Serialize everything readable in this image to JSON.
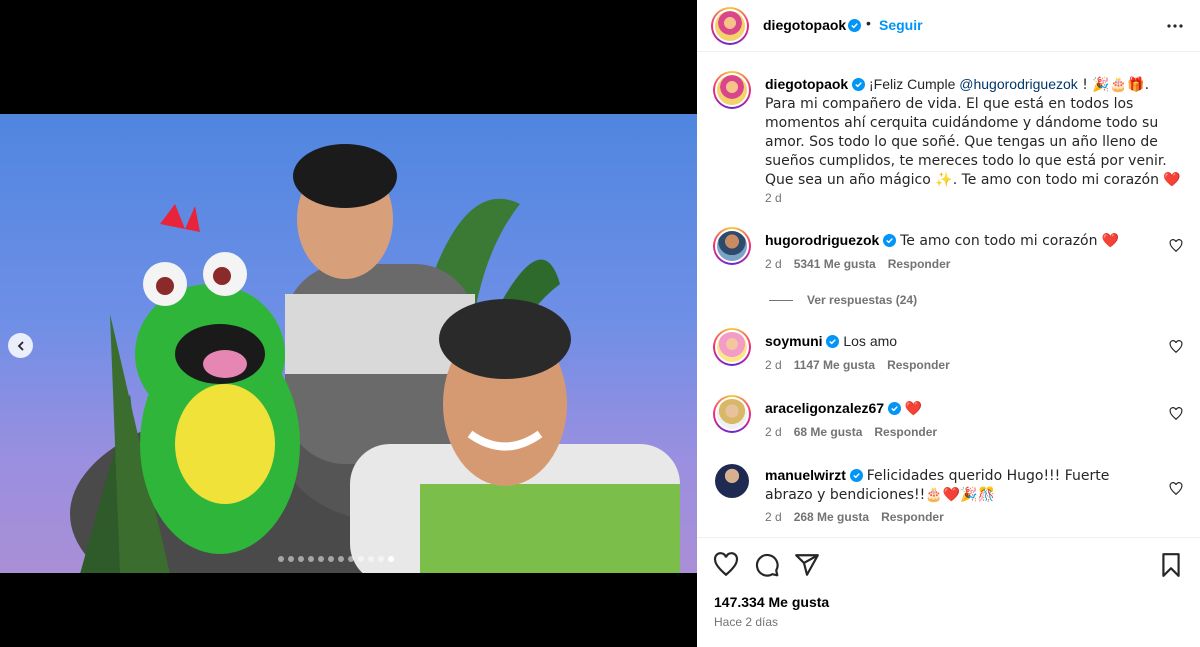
{
  "post": {
    "author": "diegotopaok",
    "follow_label": "Seguir",
    "more_icon": "more-horizontal-icon",
    "caption": {
      "pre": "¡Feliz Cumple ",
      "mention": "@hugorodriguezok",
      "post": " ! 🎉🎂🎁. Para mi compañero de vida. El que está en todos los momentos ahí cerquita cuidándome y dándome todo su amor. Sos todo lo que soñé. Que tengas un año lleno de sueños cumplidos, te mereces todo lo que está por venir. Que sea un año mágico ✨. Te amo con todo mi corazón ❤️",
      "time": "2 d"
    },
    "carousel": {
      "slide_count": 12,
      "active_index": 11
    }
  },
  "comments": [
    {
      "user": "hugorodriguezok",
      "text": "Te amo con todo mi corazón ❤️",
      "time": "2 d",
      "likes": "5341 Me gusta",
      "reply": "Responder",
      "view_replies": "Ver respuestas (24)"
    },
    {
      "user": "soymuni",
      "text": "Los amo",
      "time": "2 d",
      "likes": "1147 Me gusta",
      "reply": "Responder"
    },
    {
      "user": "araceligonzalez67",
      "text": "❤️",
      "time": "2 d",
      "likes": "68 Me gusta",
      "reply": "Responder"
    },
    {
      "user": "manuelwirzt",
      "text": "Felicidades querido Hugo!!! Fuerte abrazo y bendiciones!!🎂❤️🎉🎊",
      "time": "2 d",
      "likes": "268 Me gusta",
      "reply": "Responder"
    }
  ],
  "footer": {
    "likes": "147.334 Me gusta",
    "time": "Hace 2 días"
  },
  "colors": {
    "accent": "#0095f6",
    "muted": "#737373",
    "verified": "#0095f6",
    "heart": "#ed4956"
  }
}
